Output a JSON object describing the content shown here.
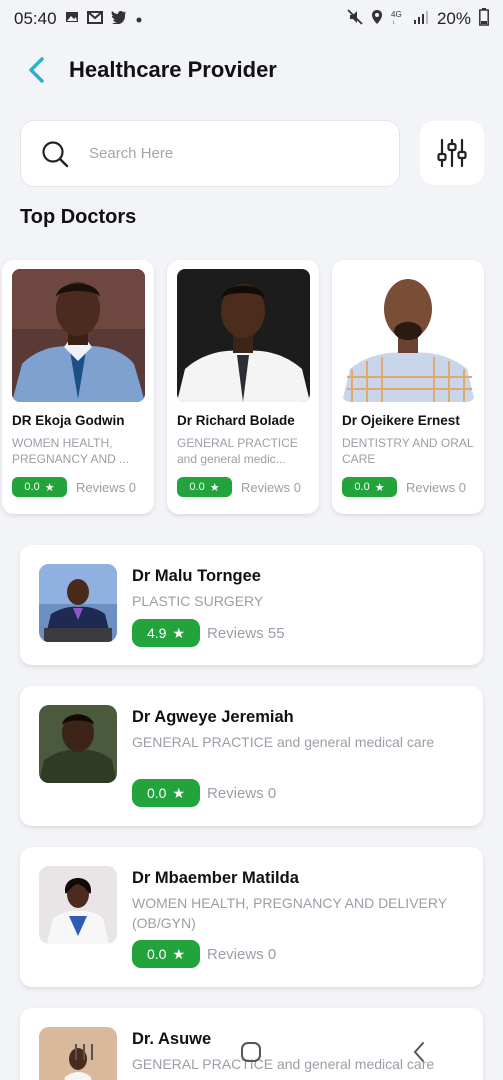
{
  "status_bar": {
    "time": "05:40",
    "battery": "20%",
    "left_icons": [
      "image-icon",
      "gmail-icon",
      "twitter-icon",
      "dot-icon"
    ],
    "right_icons": [
      "mute-icon",
      "location-icon",
      "4g-icon",
      "signal-icon",
      "battery-icon"
    ]
  },
  "header": {
    "title": "Healthcare Provider"
  },
  "search": {
    "placeholder": "Search Here",
    "value": ""
  },
  "section": {
    "title": "Top Doctors"
  },
  "top_doctors": [
    {
      "name": "DR Ekoja Godwin",
      "specialty": "WOMEN HEALTH, PREGNANCY AND ...",
      "rating": "0.0",
      "reviews": "Reviews 0"
    },
    {
      "name": "Dr Richard Bolade",
      "specialty": "GENERAL PRACTICE and general medic...",
      "rating": "0.0",
      "reviews": "Reviews 0"
    },
    {
      "name": "Dr Ojeikere Ernest",
      "specialty": "DENTISTRY AND ORAL CARE",
      "rating": "0.0",
      "reviews": "Reviews 0"
    }
  ],
  "doctors": [
    {
      "name": "Dr Malu Torngee",
      "specialty": "PLASTIC SURGERY",
      "rating": "4.9",
      "reviews": "Reviews 55"
    },
    {
      "name": "Dr Agweye Jeremiah",
      "specialty": "GENERAL PRACTICE and general medical care",
      "rating": "0.0",
      "reviews": "Reviews 0"
    },
    {
      "name": "Dr Mbaember Matilda",
      "specialty": "WOMEN HEALTH, PREGNANCY AND DELIVERY (OB/GYN)",
      "rating": "0.0",
      "reviews": "Reviews 0"
    },
    {
      "name": "Dr. Asuwe",
      "specialty": "GENERAL PRACTICE and general medical care"
    }
  ],
  "colors": {
    "accent": "#2ab3c8",
    "rating_green": "#22a33b",
    "muted_text": "#9a9ea6"
  },
  "nav": [
    "recent-apps-icon",
    "home-icon",
    "back-icon"
  ]
}
